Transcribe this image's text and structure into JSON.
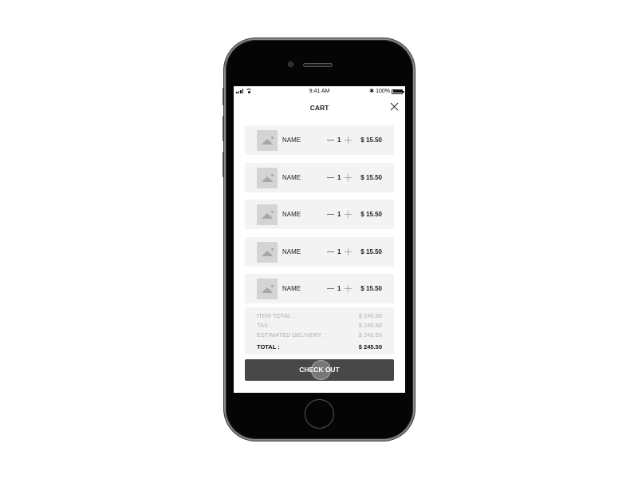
{
  "status_bar": {
    "time": "9:41 AM",
    "battery": "100%",
    "signal_icon": "signal-bars-icon",
    "wifi_icon": "wifi-icon",
    "bluetooth_icon": "bluetooth-icon",
    "battery_icon": "battery-icon"
  },
  "header": {
    "title": "CART",
    "close_icon": "close-icon"
  },
  "cart": {
    "items": [
      {
        "name": "NAME",
        "quantity": "1",
        "price": "$ 15.50",
        "image_icon": "image-placeholder-icon"
      },
      {
        "name": "NAME",
        "quantity": "1",
        "price": "$ 15.50",
        "image_icon": "image-placeholder-icon"
      },
      {
        "name": "NAME",
        "quantity": "1",
        "price": "$ 15.50",
        "image_icon": "image-placeholder-icon"
      },
      {
        "name": "NAME",
        "quantity": "1",
        "price": "$ 15.50",
        "image_icon": "image-placeholder-icon"
      },
      {
        "name": "NAME",
        "quantity": "1",
        "price": "$ 15.50",
        "image_icon": "image-placeholder-icon"
      }
    ]
  },
  "summary": {
    "item_total_label": "ITEM TOTAL :",
    "item_total_value": "$ 245.50",
    "tax_label": "TAX :",
    "tax_value": "$ 245.50",
    "delivery_label": "ESTIMATED DELIVERY :",
    "delivery_value": "$ 245.50",
    "total_label": "TOTAL :",
    "total_value": "$ 245.50"
  },
  "checkout": {
    "label": "CHECK OUT"
  },
  "colors": {
    "item_background": "#f3f3f3",
    "checkout_button": "#47484a",
    "muted_text": "#b0b0b0",
    "phone_body": "#050505"
  }
}
